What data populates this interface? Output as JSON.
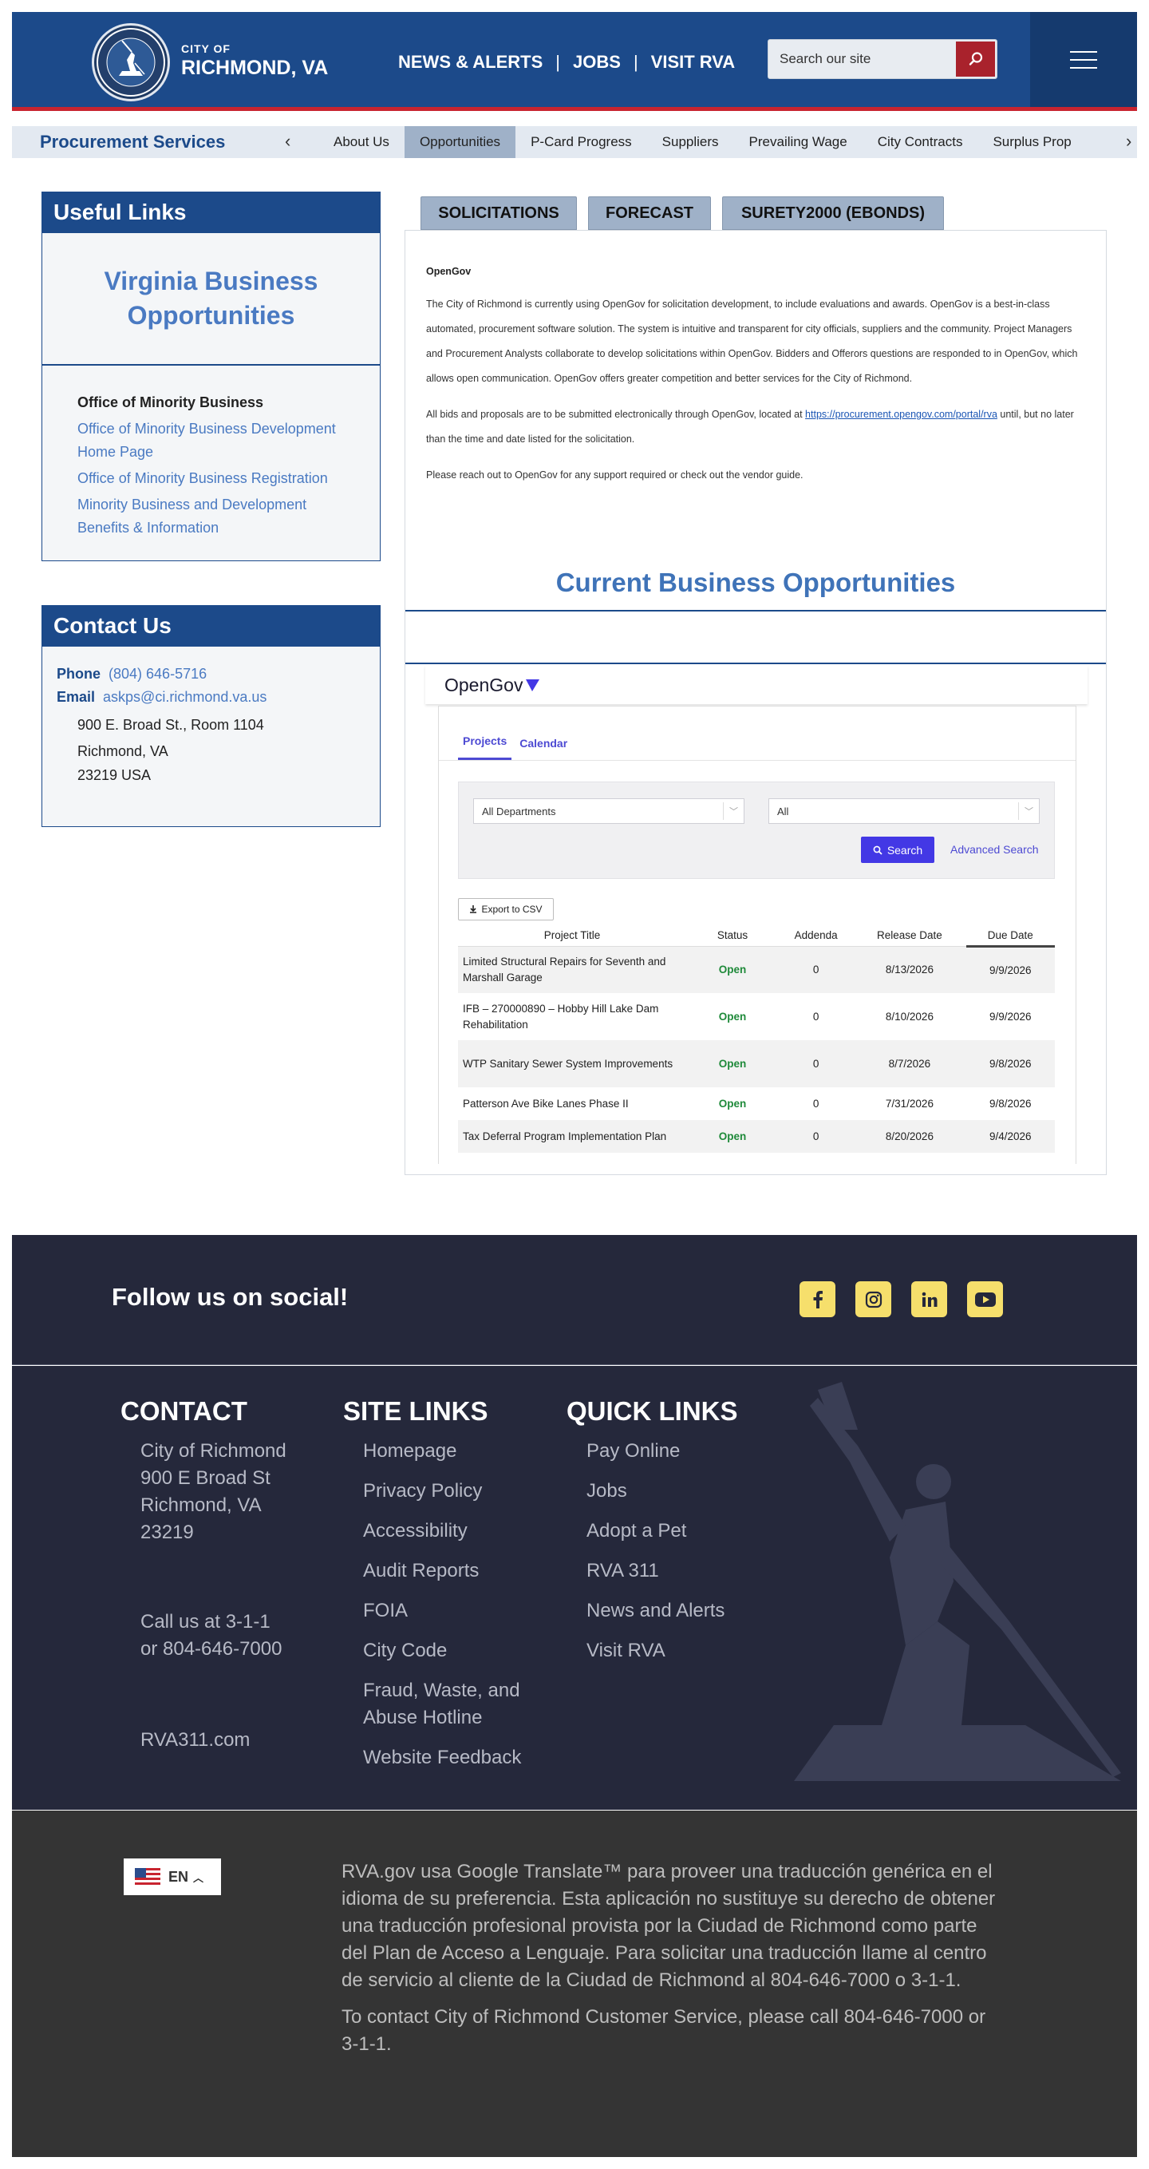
{
  "header": {
    "city_small": "CITY OF",
    "city_big": "RICHMOND, VA",
    "nav": [
      "NEWS & ALERTS",
      "JOBS",
      "VISIT RVA"
    ],
    "search_placeholder": "Search our site"
  },
  "subnav": {
    "title": "Procurement Services",
    "items": [
      "About Us",
      "Opportunities",
      "P-Card Progress",
      "Suppliers",
      "Prevailing Wage",
      "City Contracts",
      "Surplus Prop"
    ],
    "active": "Opportunities"
  },
  "sidebar": {
    "useful_title": "Useful Links",
    "vbo": "Virginia Business Opportunities",
    "omb_title": "Office of Minority Business",
    "omb_links": [
      "Office of Minority Business Development Home Page",
      "Office of Minority Business Registration",
      "Minority Business and Development Benefits & Information"
    ],
    "contact_title": "Contact Us",
    "phone_label": "Phone",
    "phone": "(804) 646-5716",
    "email_label": "Email",
    "email": "askps@ci.richmond.va.us",
    "address": [
      "900 E. Broad St., Room 1104",
      "Richmond, VA",
      "23219 USA"
    ]
  },
  "tabs": [
    "SOLICITATIONS",
    "FORECAST",
    "SURETY2000 (EBONDS)"
  ],
  "opengov": {
    "heading": "OpenGov",
    "p1": "The City of Richmond is currently using OpenGov for solicitation development, to include evaluations and awards. OpenGov is a best-in-class automated, procurement software solution.  The system is intuitive and transparent for city officials, suppliers and the community. Project Managers and Procurement Analysts collaborate to develop solicitations within OpenGov. Bidders and Offerors questions are responded to in OpenGov, which allows open communication.  OpenGov offers greater competition and better services for the City of Richmond.",
    "p2_before": "All bids and proposals are to be submitted electronically through OpenGov, located at ",
    "p2_link": "https://procurement.opengov.com/portal/rva",
    "p2_after": " until, but no later than the time and date listed for the solicitation.",
    "p3": "Please reach out to OpenGov for any support required or check out the vendor guide."
  },
  "cbo_title": "Current Business Opportunities",
  "embed": {
    "logo": "OpenGov",
    "sub_tabs": [
      "Projects",
      "Calendar"
    ],
    "dept_select": "All Departments",
    "status_select": "All",
    "search_btn": "Search",
    "advanced": "Advanced Search",
    "export": "Export to CSV",
    "columns": [
      "Project Title",
      "Status",
      "Addenda",
      "Release Date",
      "Due Date"
    ],
    "rows": [
      {
        "title": "Limited Structural Repairs for Seventh and Marshall Garage",
        "status": "Open",
        "addenda": "0",
        "release": "8/13/2026",
        "due": "9/9/2026"
      },
      {
        "title": "IFB – 270000890 – Hobby Hill Lake Dam Rehabilitation",
        "status": "Open",
        "addenda": "0",
        "release": "8/10/2026",
        "due": "9/9/2026"
      },
      {
        "title": "WTP Sanitary Sewer System Improvements",
        "status": "Open",
        "addenda": "0",
        "release": "8/7/2026",
        "due": "9/8/2026"
      },
      {
        "title": "Patterson Ave Bike Lanes Phase II",
        "status": "Open",
        "addenda": "0",
        "release": "7/31/2026",
        "due": "9/8/2026"
      },
      {
        "title": "Tax Deferral Program Implementation Plan",
        "status": "Open",
        "addenda": "0",
        "release": "8/20/2026",
        "due": "9/4/2026"
      }
    ]
  },
  "social": {
    "title": "Follow us on social!",
    "icons": [
      "facebook-icon",
      "instagram-icon",
      "linkedin-icon",
      "youtube-icon"
    ]
  },
  "footer": {
    "contact_title": "CONTACT",
    "contact_lines": [
      "City of Richmond",
      "900 E Broad St",
      "Richmond, VA",
      "23219"
    ],
    "call_lines": [
      "Call us at 3-1-1",
      "or 804-646-7000"
    ],
    "rva311": "RVA311.com",
    "site_title": "SITE LINKS",
    "site_links": [
      "Homepage",
      "Privacy Policy",
      "Accessibility",
      "Audit Reports",
      "FOIA",
      "City Code",
      "Fraud, Waste, and Abuse Hotline",
      "Website Feedback"
    ],
    "quick_title": "QUICK LINKS",
    "quick_links": [
      "Pay Online",
      "Jobs",
      "Adopt a Pet",
      "RVA 311",
      "News and Alerts",
      "Visit RVA"
    ]
  },
  "translate": {
    "lang": "EN",
    "p1": "RVA.gov usa Google Translate™ para proveer una traducción genérica en el idioma de su preferencia. Esta aplicación no sustituye su derecho de obtener una traducción profesional provista por la Ciudad de Richmond como parte del Plan de Acceso a Lenguaje. Para solicitar una traducción llame al centro de servicio al cliente  de la Ciudad de Richmond al 804-646-7000 o 3-1-1.",
    "p2": "To contact City of Richmond Customer Service, please call 804-646-7000 or 3-1-1."
  },
  "colors": {
    "brand_blue": "#1c4a8a",
    "accent_red": "#c8242f",
    "footer_navy": "#25283b",
    "social_yellow": "#f6df6c",
    "opengov_purple": "#4338e5",
    "status_green": "#1f8a3a"
  }
}
